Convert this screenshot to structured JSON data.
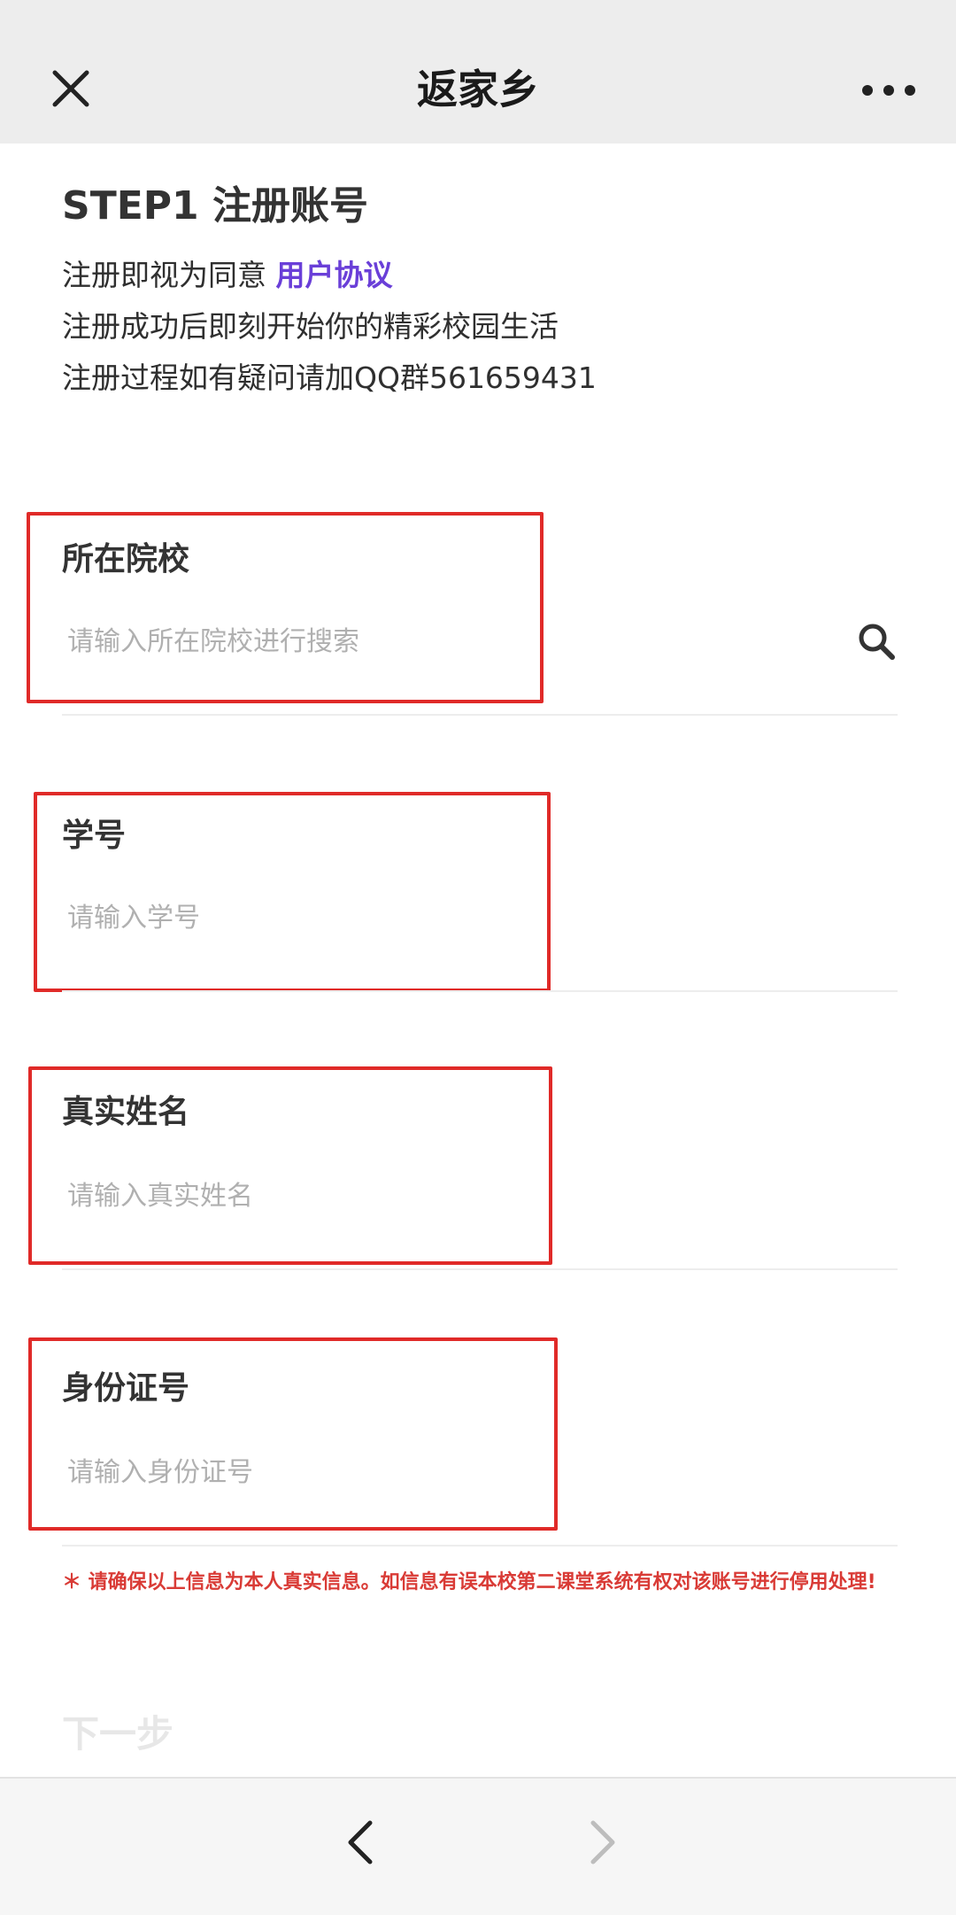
{
  "topbar": {
    "title": "返家乡",
    "close_icon": "close-icon",
    "more_icon": "more-dots-icon"
  },
  "intro": {
    "step_title": "STEP1 注册账号",
    "agree_prefix": "注册即视为同意",
    "agreement_link": "用户协议",
    "line2": "注册成功后即刻开始你的精彩校园生活",
    "line3": "注册过程如有疑问请加QQ群561659431"
  },
  "form": {
    "school": {
      "label": "所在院校",
      "placeholder": "请输入所在院校进行搜索",
      "value": ""
    },
    "student_id": {
      "label": "学号",
      "placeholder": "请输入学号",
      "value": ""
    },
    "real_name": {
      "label": "真实姓名",
      "placeholder": "请输入真实姓名",
      "value": ""
    },
    "id_number": {
      "label": "身份证号",
      "placeholder": "请输入身份证号",
      "value": ""
    }
  },
  "notice": "＊ 请确保以上信息为本人真实信息。如信息有误本校第二课堂系统有权对该账号进行停用处理!",
  "next_label": "下一步",
  "nav": {
    "back_icon": "back-arrow-icon",
    "forward_icon": "forward-arrow-icon"
  },
  "colors": {
    "highlight_border": "#e02a28",
    "link": "#6a3fd8",
    "notice": "#d93b36",
    "topbar_bg": "#ededed",
    "disabled_text": "#e7e7e7"
  }
}
